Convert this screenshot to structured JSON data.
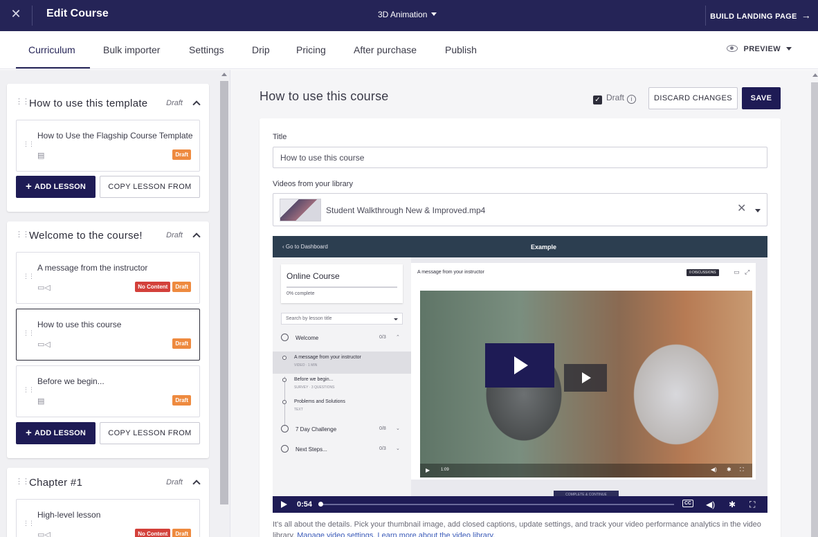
{
  "topbar": {
    "close_icon": "close-icon",
    "title": "Edit Course",
    "course_name": "3D Animation",
    "build_landing_label": "BUILD LANDING PAGE",
    "build_arrow": "→"
  },
  "tabs": [
    {
      "label": "Curriculum",
      "active": true
    },
    {
      "label": "Bulk importer"
    },
    {
      "label": "Settings"
    },
    {
      "label": "Drip"
    },
    {
      "label": "Pricing"
    },
    {
      "label": "After purchase"
    },
    {
      "label": "Publish"
    }
  ],
  "preview_label": "PREVIEW",
  "sidebar": {
    "add_lesson_label": "ADD LESSON",
    "copy_lesson_label": "COPY LESSON FROM",
    "chapters": [
      {
        "title": "How to use this template",
        "status": "Draft",
        "lessons": [
          {
            "title": "How to Use the Flagship Course Template",
            "icon": "document-icon",
            "badges": [
              "Draft"
            ]
          }
        ]
      },
      {
        "title": "Welcome to the course!",
        "status": "Draft",
        "lessons": [
          {
            "title": "A message from the instructor",
            "icon": "video-icon",
            "badges": [
              "No Content",
              "Draft"
            ]
          },
          {
            "title": "How to use this course",
            "icon": "video-icon",
            "badges": [
              "Draft"
            ],
            "selected": true
          },
          {
            "title": "Before we begin...",
            "icon": "survey-icon",
            "badges": [
              "Draft"
            ]
          }
        ]
      },
      {
        "title": "Chapter #1",
        "status": "Draft",
        "lessons": [
          {
            "title": "High-level lesson",
            "icon": "video-icon",
            "badges": [
              "No Content",
              "Draft"
            ]
          }
        ]
      }
    ]
  },
  "main": {
    "page_title": "How to use this course",
    "draft_label": "Draft",
    "draft_checked": true,
    "discard_label": "DISCARD CHANGES",
    "save_label": "SAVE",
    "title_label": "Title",
    "title_value": "How to use this course",
    "videos_label": "Videos from your library",
    "video_file": "Student Walkthrough New & Improved.mp4",
    "help_text": "It's all about the details. Pick your thumbnail image, add closed captions, update settings, and track your video performance analytics in the video library.",
    "help_link_1": "Manage video settings.",
    "help_link_2": "Learn more about the video library."
  },
  "player": {
    "back_label": "Go to Dashboard",
    "header_title": "Example",
    "course_title": "Online Course",
    "progress_text": "0% complete",
    "progress": 0,
    "search_placeholder": "Search by lesson title",
    "sections": [
      {
        "label": "Welcome",
        "count": "0/3",
        "chevron": "⌃"
      },
      {
        "label": "7 Day Challenge",
        "count": "0/8",
        "chevron": "⌄"
      },
      {
        "label": "Next Steps...",
        "count": "0/3",
        "chevron": "⌄"
      }
    ],
    "lessons": [
      {
        "title": "A message from your instructor",
        "sub": "VIDEO · 1 MIN"
      },
      {
        "title": "Before we begin...",
        "sub": "SURVEY · 3 QUESTIONS"
      },
      {
        "title": "Problems and Solutions",
        "sub": "TEXT"
      }
    ],
    "lesson_heading": "A message from your instructor",
    "discussions": "0 DISCUSSIONS",
    "inner_time": "1:09",
    "time": "0:54",
    "cc_label": "CC",
    "complete_label": "COMPLETE & CONTINUE"
  },
  "colors": {
    "brand": "#252457",
    "button": "#1e1b55",
    "badge_draft": "#ee8a3f",
    "badge_no_content": "#d3403a"
  }
}
